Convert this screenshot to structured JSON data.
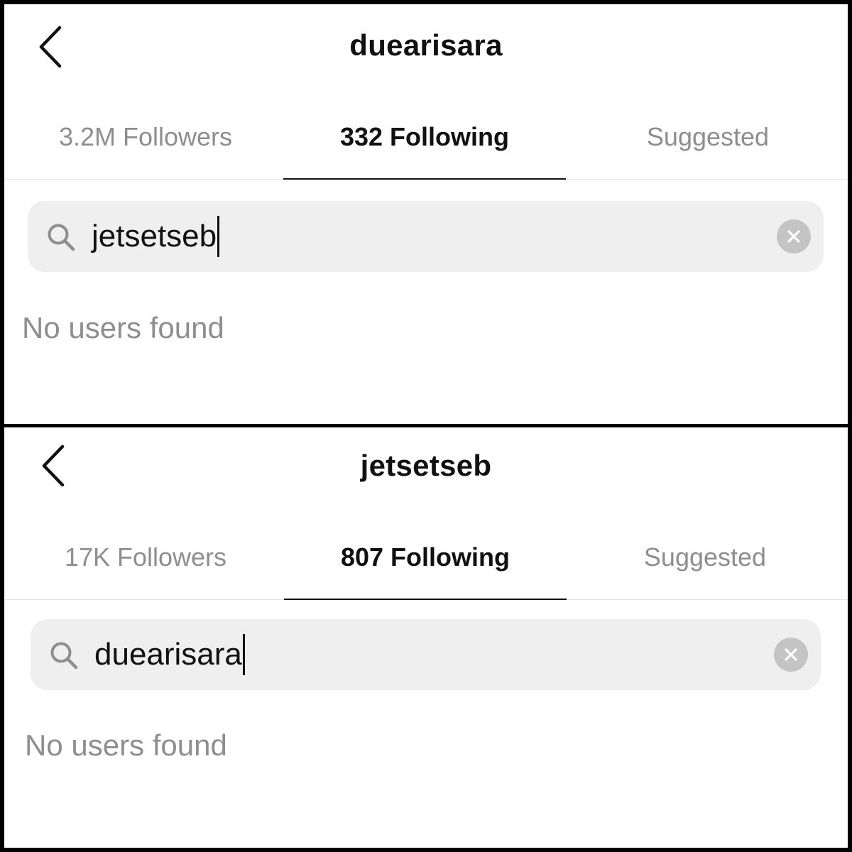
{
  "screens": [
    {
      "username": "duearisara",
      "tabs": [
        {
          "label": "3.2M Followers"
        },
        {
          "label": "332 Following"
        },
        {
          "label": "Suggested"
        }
      ],
      "active_tab": "332 Following",
      "search": {
        "value": "jetsetseb"
      },
      "empty_message": "No users found"
    },
    {
      "username": "jetsetseb",
      "tabs": [
        {
          "label": "17K Followers"
        },
        {
          "label": "807 Following"
        },
        {
          "label": "Suggested"
        }
      ],
      "active_tab": "807 Following",
      "search": {
        "value": "duearisara"
      },
      "empty_message": "No users found"
    }
  ],
  "icons": {
    "back": "chevron-left-icon",
    "search": "search-icon",
    "clear": "clear-circle-icon"
  },
  "colors": {
    "active_text": "#111111",
    "inactive_text": "#8e8e8e",
    "search_bg": "#efefef",
    "clear_bg": "#c4c4c4",
    "divider": "#e3e3e3"
  }
}
